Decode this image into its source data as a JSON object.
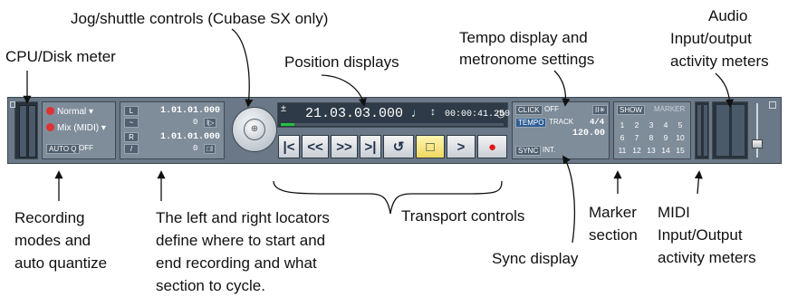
{
  "callouts": {
    "jog": "Jog/shuttle controls (Cubase SX only)",
    "audio_l1": "Audio",
    "audio_l2": "Input/output",
    "audio_l3": "activity meters",
    "tempo_l1": "Tempo display and",
    "tempo_l2": "metronome settings",
    "cpu": "CPU/Disk meter",
    "position": "Position displays",
    "rec_l1": "Recording",
    "rec_l2": "modes and",
    "rec_l3": "auto quantize",
    "loc_l1": "The left and right locators",
    "loc_l2": "define where to start and",
    "loc_l3": "end recording and what",
    "loc_l4": "section to cycle.",
    "transport": "Transport controls",
    "marker_l1": "Marker",
    "marker_l2": "section",
    "midi_l1": "MIDI",
    "midi_l2": "Input/Output",
    "midi_l3": "activity meters",
    "sync": "Sync display"
  },
  "recording": {
    "mode1": "Normal",
    "mode2": "Mix (MIDI)",
    "autoq": "AUTO Q",
    "autoq_state": "OFF"
  },
  "locators": {
    "left_label": "L",
    "right_label": "R",
    "left_time": "1.01.01.000",
    "left_ticks": "0",
    "right_time": "1.01.01.000",
    "right_ticks": "0"
  },
  "position": {
    "sign": "±",
    "primary": "21.03.03.000",
    "secondary": "00:00:41.250"
  },
  "tempo": {
    "click": "CLICK",
    "click_state": "OFF",
    "tempo_btn": "TEMPO",
    "track": "TRACK",
    "signature": "4/4",
    "bpm": "120.00",
    "sync": "SYNC",
    "sync_state": "INT."
  },
  "markers": {
    "show": "SHOW",
    "title": "MARKER",
    "row1": [
      "1",
      "2",
      "3",
      "4",
      "5"
    ],
    "row2": [
      "6",
      "7",
      "8",
      "9",
      "10"
    ],
    "row3": [
      "11",
      "12",
      "13",
      "14",
      "15"
    ]
  },
  "transport_buttons": [
    {
      "name": "go-to-start",
      "glyph": "|<"
    },
    {
      "name": "rewind",
      "glyph": "<<"
    },
    {
      "name": "fast-forward",
      "glyph": ">>"
    },
    {
      "name": "go-to-end",
      "glyph": ">|"
    },
    {
      "name": "cycle",
      "glyph": "↺"
    },
    {
      "name": "stop",
      "glyph": "□"
    },
    {
      "name": "play",
      "glyph": ">"
    },
    {
      "name": "record",
      "glyph": "●"
    }
  ],
  "colors": {
    "record": "#e01818",
    "stop_active": "#f0d860",
    "tempo_active": "#2f5f96",
    "position_bar": "#22c040"
  }
}
